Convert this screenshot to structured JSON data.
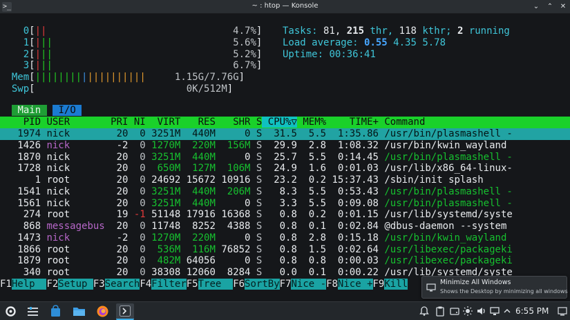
{
  "window": {
    "title": "~ : htop — Konsole"
  },
  "meters": {
    "cpu": [
      {
        "id": "0",
        "pct": "4.7%"
      },
      {
        "id": "1",
        "pct": "5.6%"
      },
      {
        "id": "2",
        "pct": "5.2%"
      },
      {
        "id": "3",
        "pct": "6.7%"
      }
    ],
    "mem": {
      "label": "Mem",
      "value": "1.15G/7.76G"
    },
    "swp": {
      "label": "Swp",
      "value": "0K/512M"
    }
  },
  "tasks": {
    "label": "Tasks:",
    "tasks": "81,",
    "thr": "215",
    "thr_label": " thr,",
    "kthr": "118",
    "kthr_label": " kthr;",
    "running": "2",
    "running_label": " running"
  },
  "load": {
    "label": "Load average:",
    "l1": "0.55",
    "l5": "4.35",
    "l15": "5.78"
  },
  "uptime": {
    "label": "Uptime:",
    "value": "00:36:41"
  },
  "tabs": {
    "main": "Main",
    "io": "I/O"
  },
  "columns": [
    "PID",
    "USER",
    "PRI",
    "NI",
    "VIRT",
    "RES",
    "SHR",
    "S",
    "CPU%▽",
    "MEM%",
    "TIME+",
    "Command"
  ],
  "processes": [
    {
      "pid": "1974",
      "user": "nick",
      "pri": "20",
      "ni": "0",
      "virt": "3251M",
      "res": "440M",
      "shr": "0",
      "s": "S",
      "cpu": "31.5",
      "mem": "5.5",
      "time": "1:35.86",
      "cmd": "/usr/bin/plasmashell -"
    },
    {
      "pid": "1426",
      "user": "nick",
      "pri": "-2",
      "ni": "0",
      "virt": "1270M",
      "res": "220M",
      "shr": "156M",
      "s": "S",
      "cpu": "29.9",
      "mem": "2.8",
      "time": "1:08.32",
      "cmd": "/usr/bin/kwin_wayland"
    },
    {
      "pid": "1870",
      "user": "nick",
      "pri": "20",
      "ni": "0",
      "virt": "3251M",
      "res": "440M",
      "shr": "0",
      "s": "S",
      "cpu": "25.7",
      "mem": "5.5",
      "time": "0:14.45",
      "cmd": "/usr/bin/plasmashell -"
    },
    {
      "pid": "1728",
      "user": "nick",
      "pri": "20",
      "ni": "0",
      "virt": "650M",
      "res": "127M",
      "shr": "106M",
      "s": "S",
      "cpu": "24.9",
      "mem": "1.6",
      "time": "0:01.03",
      "cmd": "/usr/lib/x86_64-linux-"
    },
    {
      "pid": "1",
      "user": "root",
      "pri": "20",
      "ni": "0",
      "virt": "24692",
      "res": "15672",
      "shr": "10916",
      "s": "S",
      "cpu": "23.2",
      "mem": "0.2",
      "time": "15:37.43",
      "cmd": "/sbin/init splash"
    },
    {
      "pid": "1541",
      "user": "nick",
      "pri": "20",
      "ni": "0",
      "virt": "3251M",
      "res": "440M",
      "shr": "206M",
      "s": "S",
      "cpu": "8.3",
      "mem": "5.5",
      "time": "0:53.43",
      "cmd": "/usr/bin/plasmashell -"
    },
    {
      "pid": "1561",
      "user": "nick",
      "pri": "20",
      "ni": "0",
      "virt": "3251M",
      "res": "440M",
      "shr": "0",
      "s": "S",
      "cpu": "3.3",
      "mem": "5.5",
      "time": "0:09.08",
      "cmd": "/usr/bin/plasmashell -"
    },
    {
      "pid": "274",
      "user": "root",
      "pri": "19",
      "ni": "-1",
      "virt": "51148",
      "res": "17916",
      "shr": "16368",
      "s": "S",
      "cpu": "0.8",
      "mem": "0.2",
      "time": "0:01.15",
      "cmd": "/usr/lib/systemd/syste"
    },
    {
      "pid": "868",
      "user": "messagebus",
      "pri": "20",
      "ni": "0",
      "virt": "11748",
      "res": "8252",
      "shr": "4388",
      "s": "S",
      "cpu": "0.8",
      "mem": "0.1",
      "time": "0:02.84",
      "cmd": "@dbus-daemon --system"
    },
    {
      "pid": "1473",
      "user": "nick",
      "pri": "-2",
      "ni": "0",
      "virt": "1270M",
      "res": "220M",
      "shr": "0",
      "s": "S",
      "cpu": "0.8",
      "mem": "2.8",
      "time": "0:15.18",
      "cmd": "/usr/bin/kwin_wayland"
    },
    {
      "pid": "1866",
      "user": "root",
      "pri": "20",
      "ni": "0",
      "virt": "536M",
      "res": "116M",
      "shr": "76852",
      "s": "S",
      "cpu": "0.8",
      "mem": "1.5",
      "time": "0:02.64",
      "cmd": "/usr/libexec/packageki"
    },
    {
      "pid": "1879",
      "user": "root",
      "pri": "20",
      "ni": "0",
      "virt": "482M",
      "res": "64056",
      "shr": "0",
      "s": "S",
      "cpu": "0.8",
      "mem": "0.8",
      "time": "0:00.03",
      "cmd": "/usr/libexec/packageki"
    },
    {
      "pid": "340",
      "user": "root",
      "pri": "20",
      "ni": "0",
      "virt": "38308",
      "res": "12060",
      "shr": "8284",
      "s": "S",
      "cpu": "0.0",
      "mem": "0.1",
      "time": "0:00.22",
      "cmd": "/usr/lib/systemd/syste"
    }
  ],
  "fkeys": [
    {
      "key": "F1",
      "name": "Help  "
    },
    {
      "key": "F2",
      "name": "Setup "
    },
    {
      "key": "F3",
      "name": "Search"
    },
    {
      "key": "F4",
      "name": "Filter"
    },
    {
      "key": "F5",
      "name": "Tree  "
    },
    {
      "key": "F6",
      "name": "SortBy"
    },
    {
      "key": "F7",
      "name": "Nice -"
    },
    {
      "key": "F8",
      "name": "Nice +"
    },
    {
      "key": "F9",
      "name": "Kill"
    }
  ],
  "tooltip": {
    "title": "Minimize All Windows",
    "desc": "Shows the Desktop by minimizing all windows"
  },
  "clock": "6:55 PM",
  "colors": {
    "accent_green": "#1ad12a",
    "accent_cyan": "#21a3a3",
    "terminal_bg": "#15171a"
  }
}
